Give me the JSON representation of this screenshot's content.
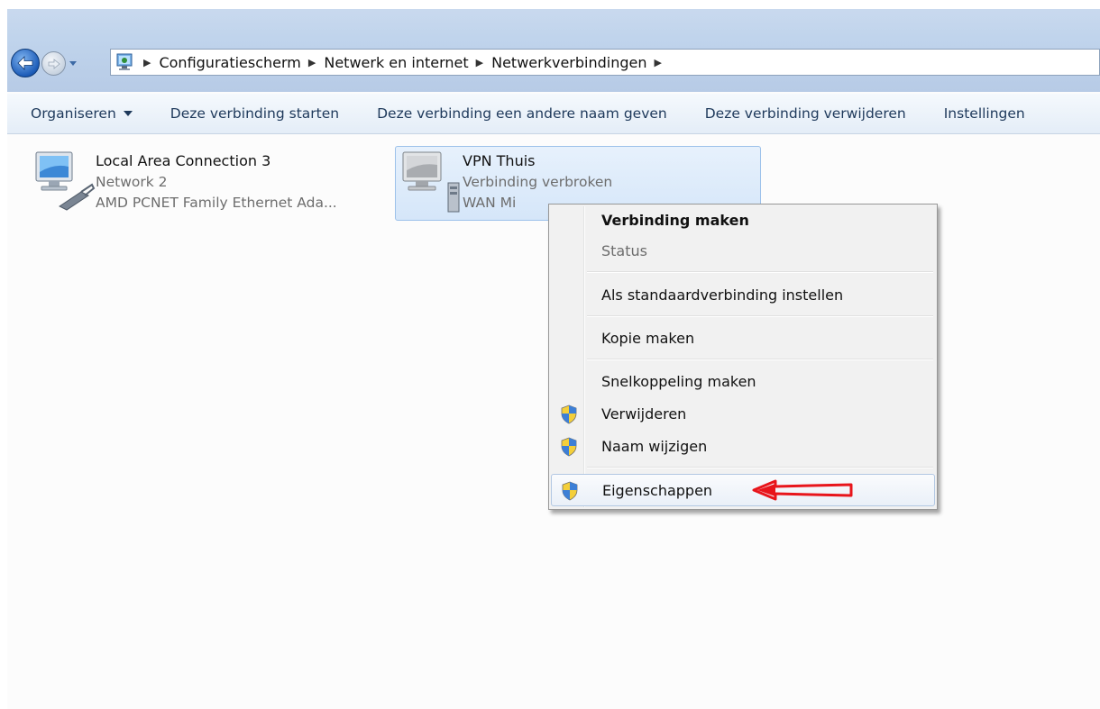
{
  "breadcrumb": {
    "items": [
      "Configuratiescherm",
      "Netwerk en internet",
      "Netwerkverbindingen"
    ]
  },
  "toolbar": {
    "organize_label": "Organiseren",
    "start_label": "Deze verbinding starten",
    "rename_label": "Deze verbinding een andere naam geven",
    "delete_label": "Deze verbinding verwijderen",
    "settings_label": "Instellingen"
  },
  "connections": [
    {
      "name": "Local Area Connection 3",
      "network": "Network 2",
      "device": "AMD PCNET Family Ethernet Ada...",
      "icon": "network-adapter-icon",
      "selected": false
    },
    {
      "name": "VPN Thuis",
      "network": "Verbinding verbroken",
      "device": "WAN Mi",
      "icon": "vpn-connection-icon",
      "selected": true
    }
  ],
  "context_menu": {
    "items": [
      {
        "label": "Verbinding maken",
        "bold": true,
        "disabled": false,
        "shield": false
      },
      {
        "label": "Status",
        "bold": false,
        "disabled": true,
        "shield": false
      },
      {
        "label": "Als standaardverbinding instellen",
        "bold": false,
        "disabled": false,
        "shield": false
      },
      {
        "label": "Kopie maken",
        "bold": false,
        "disabled": false,
        "shield": false
      },
      {
        "label": "Snelkoppeling maken",
        "bold": false,
        "disabled": false,
        "shield": false
      },
      {
        "label": "Verwijderen",
        "bold": false,
        "disabled": false,
        "shield": true
      },
      {
        "label": "Naam wijzigen",
        "bold": false,
        "disabled": false,
        "shield": true
      },
      {
        "label": "Eigenschappen",
        "bold": false,
        "disabled": false,
        "shield": true,
        "highlighted": true
      }
    ]
  },
  "colors": {
    "selection_border": "#9cc1ea",
    "annotation_arrow": "#e8151b",
    "toolbar_text": "#1e395b"
  }
}
